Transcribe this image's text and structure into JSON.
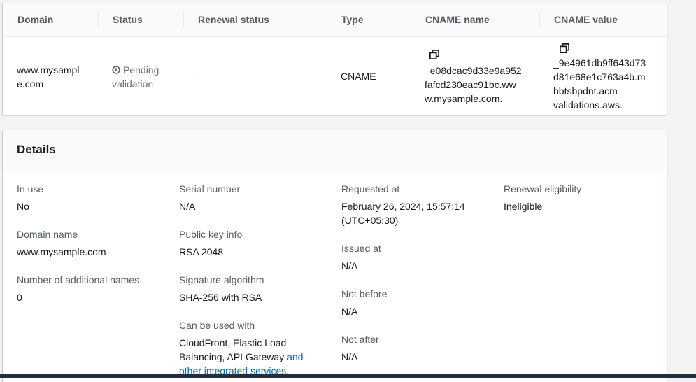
{
  "domains_table": {
    "headers": {
      "domain": "Domain",
      "status": "Status",
      "renewal_status": "Renewal status",
      "type": "Type",
      "cname_name": "CNAME name",
      "cname_value": "CNAME value"
    },
    "row": {
      "domain_line1": "www.mysampl",
      "domain_line2": "e.com",
      "status_line1": "Pending",
      "status_line2": "validation",
      "renewal_status": "-",
      "type": "CNAME",
      "cname_name_lines": [
        "_e08dcac9d33e9a952",
        "fafcd230eac91bc.ww",
        "w.mysample.com."
      ],
      "cname_value_lines": [
        "_9e4961db9ff643d73",
        "d81e68e1c763a4b.m",
        "hbtsbpdnt.acm-",
        "validations.aws."
      ]
    }
  },
  "details": {
    "title": "Details",
    "in_use_label": "In use",
    "in_use_value": "No",
    "domain_name_label": "Domain name",
    "domain_name_value": "www.mysample.com",
    "additional_names_label": "Number of additional names",
    "additional_names_value": "0",
    "serial_label": "Serial number",
    "serial_value": "N/A",
    "public_key_label": "Public key info",
    "public_key_value": "RSA 2048",
    "sig_alg_label": "Signature algorithm",
    "sig_alg_value": "SHA-256 with RSA",
    "used_with_label": "Can be used with",
    "used_with_line1": "CloudFront, Elastic Load",
    "used_with_line2": "Balancing, API Gateway",
    "used_with_link1": "and",
    "used_with_link2": "other integrated services.",
    "requested_label": "Requested at",
    "requested_line1": "February 26, 2024, 15:57:14",
    "requested_line2": "(UTC+05:30)",
    "issued_label": "Issued at",
    "issued_value": "N/A",
    "not_before_label": "Not before",
    "not_before_value": "N/A",
    "not_after_label": "Not after",
    "not_after_value": "N/A",
    "renewal_label": "Renewal eligibility",
    "renewal_value": "Ineligible"
  },
  "icons": {
    "status_icon": "clock-icon",
    "copy_icon": "copy-icon"
  },
  "colors": {
    "link": "#0073bb",
    "status_pending": "#687078",
    "background": "#f2f3f3"
  }
}
